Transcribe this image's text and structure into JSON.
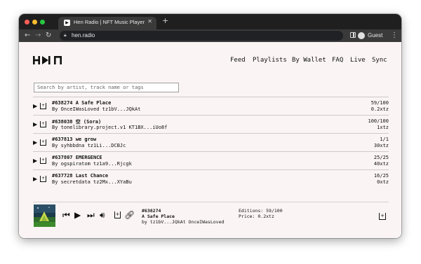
{
  "browser": {
    "tab_title": "Hen Radio | NFT Music Player",
    "url": "hen.radio",
    "profile_label": "Guest"
  },
  "site": {
    "nav": [
      "Feed",
      "Playlists",
      "By Wallet",
      "FAQ",
      "Live",
      "Sync"
    ],
    "search_placeholder": "Search by artist, track name or tags"
  },
  "tracks": [
    {
      "title": "#638274 A Safe Place",
      "by": "By OnceIWasLoved tz1bV...JQkAt",
      "editions": "59/100",
      "price": "0.2xtz"
    },
    {
      "title": "#638038 空 (Sora)",
      "by": "By tonelibrary.project.v1 KT1BX...iUo8f",
      "editions": "100/100",
      "price": "1xtz"
    },
    {
      "title": "#637813 we grow",
      "by": "By syhbbdna tz1Li...DCBJc",
      "editions": "1/1",
      "price": "30xtz"
    },
    {
      "title": "#637807 EMERGENCE",
      "by": "By ogspiratom tz1a9...Rjcgk",
      "editions": "25/25",
      "price": "40xtz"
    },
    {
      "title": "#637728 Last Chance",
      "by": "By secretdata tz2Mx...XYaBu",
      "editions": "16/25",
      "price": "0xtz"
    }
  ],
  "player": {
    "track_id": "#638274",
    "track_title": "A Safe Place",
    "by_line": "by tz1bV...JQkAt OnceIWasLoved",
    "editions": "Editions: 59/100",
    "price": "Price: 0.2xtz"
  }
}
